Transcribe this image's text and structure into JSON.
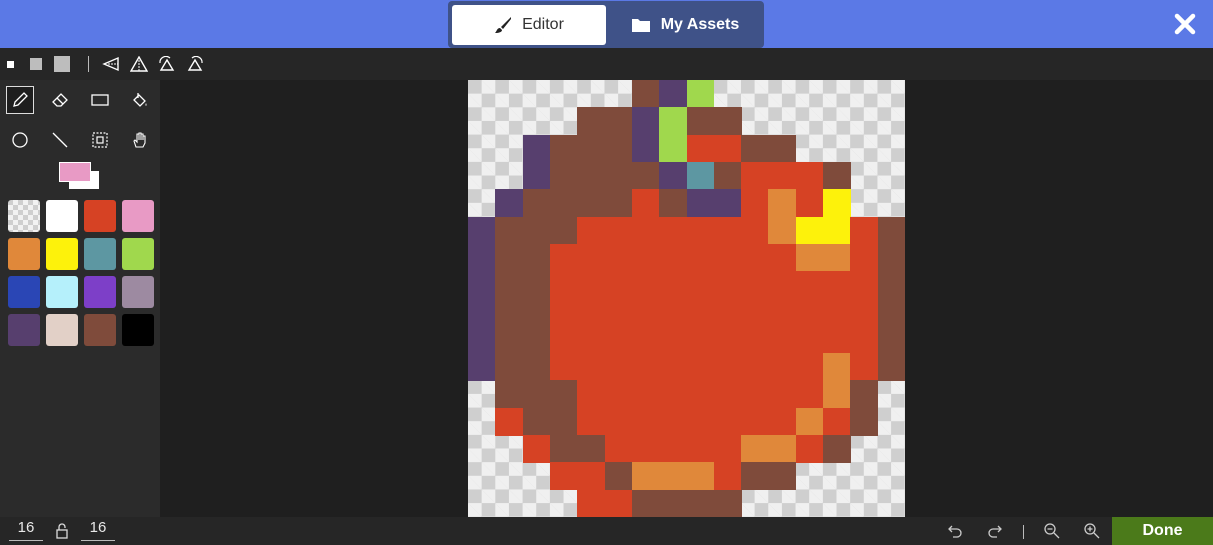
{
  "header": {
    "tabs": [
      {
        "label": "Editor",
        "icon": "brush-icon",
        "active": true
      },
      {
        "label": "My Assets",
        "icon": "folder-icon",
        "active": false
      }
    ],
    "close_icon": "close-icon"
  },
  "subtoolbar": {
    "brush_sizes": [
      "small",
      "medium",
      "large"
    ],
    "transform_tools": [
      "flip-horizontal-icon",
      "flip-vertical-icon",
      "rotate-ccw-icon",
      "rotate-cw-icon"
    ]
  },
  "tools": [
    {
      "name": "pencil",
      "icon": "pencil-icon",
      "active": true
    },
    {
      "name": "eraser",
      "icon": "eraser-icon",
      "active": false
    },
    {
      "name": "rectangle",
      "icon": "rectangle-icon",
      "active": false
    },
    {
      "name": "fill",
      "icon": "paint-bucket-icon",
      "active": false
    },
    {
      "name": "circle",
      "icon": "circle-icon",
      "active": false
    },
    {
      "name": "line",
      "icon": "line-icon",
      "active": false
    },
    {
      "name": "marquee",
      "icon": "select-icon",
      "active": false
    },
    {
      "name": "pan",
      "icon": "hand-icon",
      "active": false
    }
  ],
  "current_colors": {
    "primary": "#e89ac5",
    "secondary": "#ffffff"
  },
  "palette": [
    "transparent",
    "#ffffff",
    "#d64224",
    "#e89ac5",
    "#e0883a",
    "#fdf20b",
    "#5d97a2",
    "#a0d84d",
    "#2a46b5",
    "#b5f0fb",
    "#7d3fc8",
    "#9d8aa1",
    "#573f6e",
    "#e2d0c7",
    "#7f4b3b",
    "#000000"
  ],
  "canvas": {
    "grid_size": 16,
    "color_keys": {
      "R": "#d64224",
      "B": "#7f4b3b",
      "P": "#573f6e",
      "G": "#a0d84d",
      "T": "#5d97a2",
      "O": "#e0883a",
      "Y": "#fdf20b",
      ".": "transparent"
    },
    "rows": [
      "......BPG.......",
      "....BBPGBB......",
      "..PBBBPGRRBB....",
      "..PBBBBPTBRRRB..",
      ".PBBBBRBPPRORY",
      "PBBBRRRRRRROYYRB",
      "PBBRRRRRRRRROORB",
      "PBBRRRRRRRRRRRRB",
      "PBBRRRRRRRRRRRRB",
      "PBBRRRRRRRRRRRRB",
      "PBBRRRRRRRRRRORB",
      ".BBBRRRRRRRRROB.",
      ".RBBRRRRRRRRORB.",
      "..RBBRRRRROORB..",
      "...RRBOOORBB....",
      "....RRBBBB......"
    ]
  },
  "bottom": {
    "width": "16",
    "height": "16",
    "lock_icon": "lock-icon",
    "done_label": "Done"
  }
}
